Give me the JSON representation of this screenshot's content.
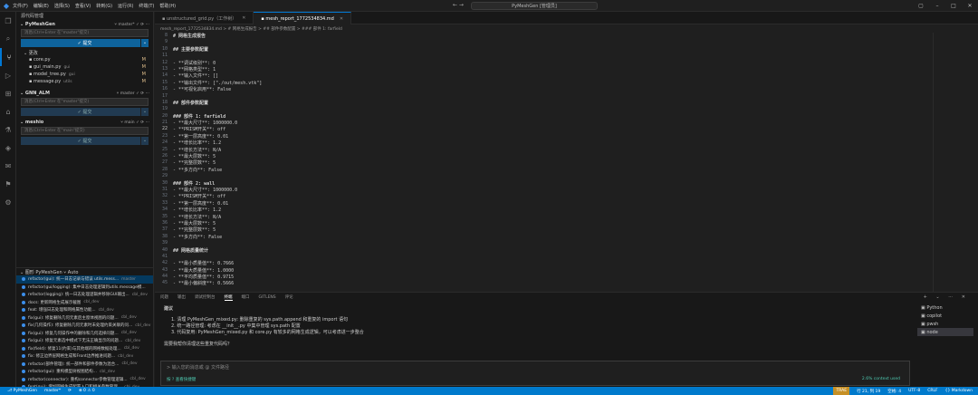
{
  "titlebar": {
    "menu": [
      "文件(F)",
      "编辑(E)",
      "选择(S)",
      "查看(V)",
      "转到(G)",
      "运行(R)",
      "终端(T)",
      "帮助(H)"
    ],
    "command_center": "PyMeshGen [管理员]",
    "nav_arrows": "← →"
  },
  "activity_icons": [
    "files-icon",
    "search-icon",
    "source-control-icon",
    "run-debug-icon",
    "extensions-icon",
    "remote-icon",
    "testing-icon",
    "gitlens-icon",
    "chat-icon",
    "bookmark-icon",
    "settings-sync-icon"
  ],
  "sidebar": {
    "header": "源代码管理",
    "repos": [
      {
        "name": "PyMeshGen",
        "branch": "master*",
        "placeholder": "消息(Ctrl+Enter 在\"master\"提交)",
        "commit_label": "✓ 提交",
        "changes_label": "更改",
        "files": [
          {
            "name": "core.py",
            "path": "",
            "status": "M"
          },
          {
            "name": "gui_main.py",
            "path": "gui",
            "status": "M"
          },
          {
            "name": "model_tree.py",
            "path": "gui",
            "status": "M"
          },
          {
            "name": "message.py",
            "path": "utils",
            "status": "M"
          }
        ]
      },
      {
        "name": "GNN_ALM",
        "branch": "master",
        "placeholder": "消息(Ctrl+Enter 在\"master\"提交)",
        "commit_label": "✓ 提交"
      },
      {
        "name": "meshio",
        "branch": "main",
        "placeholder": "消息(Ctrl+Enter 在\"main\"提交)",
        "commit_label": "✓ 提交"
      }
    ],
    "graph_header": "图形",
    "graph_repo": "PyMeshGen",
    "graph_branch": "Auto",
    "graph": [
      {
        "msg": "refactor(gui): 统一日志记录与错误 utils.mess...",
        "author": "master",
        "sel": true
      },
      {
        "msg": "refactor(gui/logging): 集中日志处理逻辑到utils.message模...",
        "author": ""
      },
      {
        "msg": "refactor(logging): 统一日志处理逻辑并移除GUI输出...",
        "author": "cbl_dev"
      },
      {
        "msg": "docs: 更新网格生成展示截图",
        "author": "cbl_dev"
      },
      {
        "msg": "feat: 增强日志处理和网格属性功能...",
        "author": "cbl_dev"
      },
      {
        "msg": "fix(gui): 修复删除几何元素后主窗体视图的问题...",
        "author": "cbl_dev"
      },
      {
        "msg": "fix(几何操作): 修复删除几何元素时未处理约束关联的问...",
        "author": "cbl_dev"
      },
      {
        "msg": "fix(gui): 修复几何操作中的删除和几何选择问题...",
        "author": "cbl_dev"
      },
      {
        "msg": "fix(gui): 修复元素选中模式下无法正确显示的问题...",
        "author": "cbl_dev"
      },
      {
        "msg": "fix(field): 修复11(约束)与其他端的网格数据处理...",
        "author": "cbl_dev"
      },
      {
        "msg": "fix: 修正边界层网格生成和Front边界推进问题...",
        "author": "cbl_dev"
      },
      {
        "msg": "refactor(部件管理): 统一部件和部件参数为混合...",
        "author": "cbl_dev"
      },
      {
        "msg": "refactor(gui): 重构模型树视图结构...",
        "author": "cbl_dev"
      },
      {
        "msg": "refactor(connector): 重构connector参数管理逻辑...",
        "author": "cbl_dev"
      },
      {
        "msg": "feat(gui): 增加网格生成配置入口和相关参数管理...",
        "author": "cbl_dev"
      }
    ]
  },
  "tabs": [
    {
      "label": "unstructured_grid.py（工作树）",
      "active": false
    },
    {
      "label": "mesh_report_1772534834.md",
      "active": true
    }
  ],
  "breadcrumb": "mesh_report_1772534834.md > # 网格生成报告 > ## 部件参数配置 > ### 部件 1: farfield",
  "editor_lines": [
    {
      "n": "8",
      "t": "# 网格生成报告",
      "c": "h"
    },
    {
      "n": "9",
      "t": "",
      "c": ""
    },
    {
      "n": "10",
      "t": "## 主要参数配置",
      "c": "h"
    },
    {
      "n": "11",
      "t": "",
      "c": ""
    },
    {
      "n": "12",
      "t": "- **调试级别**: 0",
      "c": ""
    },
    {
      "n": "13",
      "t": "- **网格类型**: 1",
      "c": ""
    },
    {
      "n": "14",
      "t": "- **输入文件**: []",
      "c": ""
    },
    {
      "n": "15",
      "t": "- **输出文件**: [\"./out/mesh.vtk\"]",
      "c": ""
    },
    {
      "n": "16",
      "t": "- **可视化启用**: False",
      "c": ""
    },
    {
      "n": "17",
      "t": "",
      "c": ""
    },
    {
      "n": "18",
      "t": "## 部件参数配置",
      "c": "h"
    },
    {
      "n": "19",
      "t": "",
      "c": ""
    },
    {
      "n": "20",
      "t": "### 部件 1: farfield",
      "c": "h"
    },
    {
      "n": "21",
      "t": "- **最大尺寸**: 1000000.0",
      "c": ""
    },
    {
      "n": "22",
      "t": "- **PRISM开关**: off",
      "c": ""
    },
    {
      "n": "23",
      "t": "- **第一层高度**: 0.01",
      "c": ""
    },
    {
      "n": "24",
      "t": "- **增长比率**: 1.2",
      "c": ""
    },
    {
      "n": "25",
      "t": "- **增长方法**: N/A",
      "c": ""
    },
    {
      "n": "26",
      "t": "- **最大层数**: 5",
      "c": ""
    },
    {
      "n": "27",
      "t": "- **完整层数**: 5",
      "c": ""
    },
    {
      "n": "28",
      "t": "- **多方向**: False",
      "c": ""
    },
    {
      "n": "29",
      "t": "",
      "c": ""
    },
    {
      "n": "30",
      "t": "### 部件 2: wall",
      "c": "h"
    },
    {
      "n": "31",
      "t": "- **最大尺寸**: 1000000.0",
      "c": ""
    },
    {
      "n": "32",
      "t": "- **PRISM开关**: off",
      "c": ""
    },
    {
      "n": "33",
      "t": "- **第一层高度**: 0.01",
      "c": ""
    },
    {
      "n": "34",
      "t": "- **增长比率**: 1.2",
      "c": ""
    },
    {
      "n": "35",
      "t": "- **增长方法**: N/A",
      "c": ""
    },
    {
      "n": "36",
      "t": "- **最大层数**: 5",
      "c": ""
    },
    {
      "n": "37",
      "t": "- **完整层数**: 5",
      "c": ""
    },
    {
      "n": "38",
      "t": "- **多方向**: False",
      "c": ""
    },
    {
      "n": "39",
      "t": "",
      "c": ""
    },
    {
      "n": "40",
      "t": "## 网格质量统计",
      "c": "h"
    },
    {
      "n": "41",
      "t": "",
      "c": ""
    },
    {
      "n": "42",
      "t": "- **最小质量值**: 0.7666",
      "c": ""
    },
    {
      "n": "43",
      "t": "- **最大质量值**: 1.0000",
      "c": ""
    },
    {
      "n": "44",
      "t": "- **平均质量值**: 0.9715",
      "c": ""
    },
    {
      "n": "45",
      "t": "- **最小偏斜度**: 0.5666",
      "c": ""
    }
  ],
  "panel": {
    "tabs": [
      "问题",
      "输出",
      "调试控制台",
      "终端",
      "端口",
      "GITLENS",
      "评论"
    ],
    "active_tab": "终端",
    "tools": "+ ⌄ ⋯ ✕",
    "chat_title": "建议",
    "chat_rows": [
      "1. 清理 PyMeshGen_mixed.py: 删除重复的 sys.path.append 和重复的 import 语句",
      "2. 统一路径管理: 考虑在 __init__.py 中集中管理 sys.path 配置",
      "3. 代码复用: PyMeshGen_mixed.py 和 core.py 有较多的网格生成逻辑，可以考虑进一步整合"
    ],
    "question": "需要我帮你清理这些重复代码吗？",
    "input_placeholder": "> 输入您的消息或 @ 文件路径",
    "shortcut_hint": "按 ? 查看快捷键",
    "context_hint": "2.6% context used",
    "terminals": [
      "Python",
      "copilot",
      "pwsh",
      "node"
    ],
    "active_terminal": "node"
  },
  "status": {
    "left": [
      "⎇ PyMeshGen",
      "master*",
      "⟳",
      "⊗ 0 ⚠ 0"
    ],
    "right": [
      "行 21, 列 19",
      "空格: 4",
      "UTF-8",
      "CRLF",
      "{} Markdown"
    ],
    "badge": "TRAE"
  },
  "colors": {
    "accent": "#007acc",
    "heading": "#569cd6",
    "modified": "#e2c08d"
  }
}
